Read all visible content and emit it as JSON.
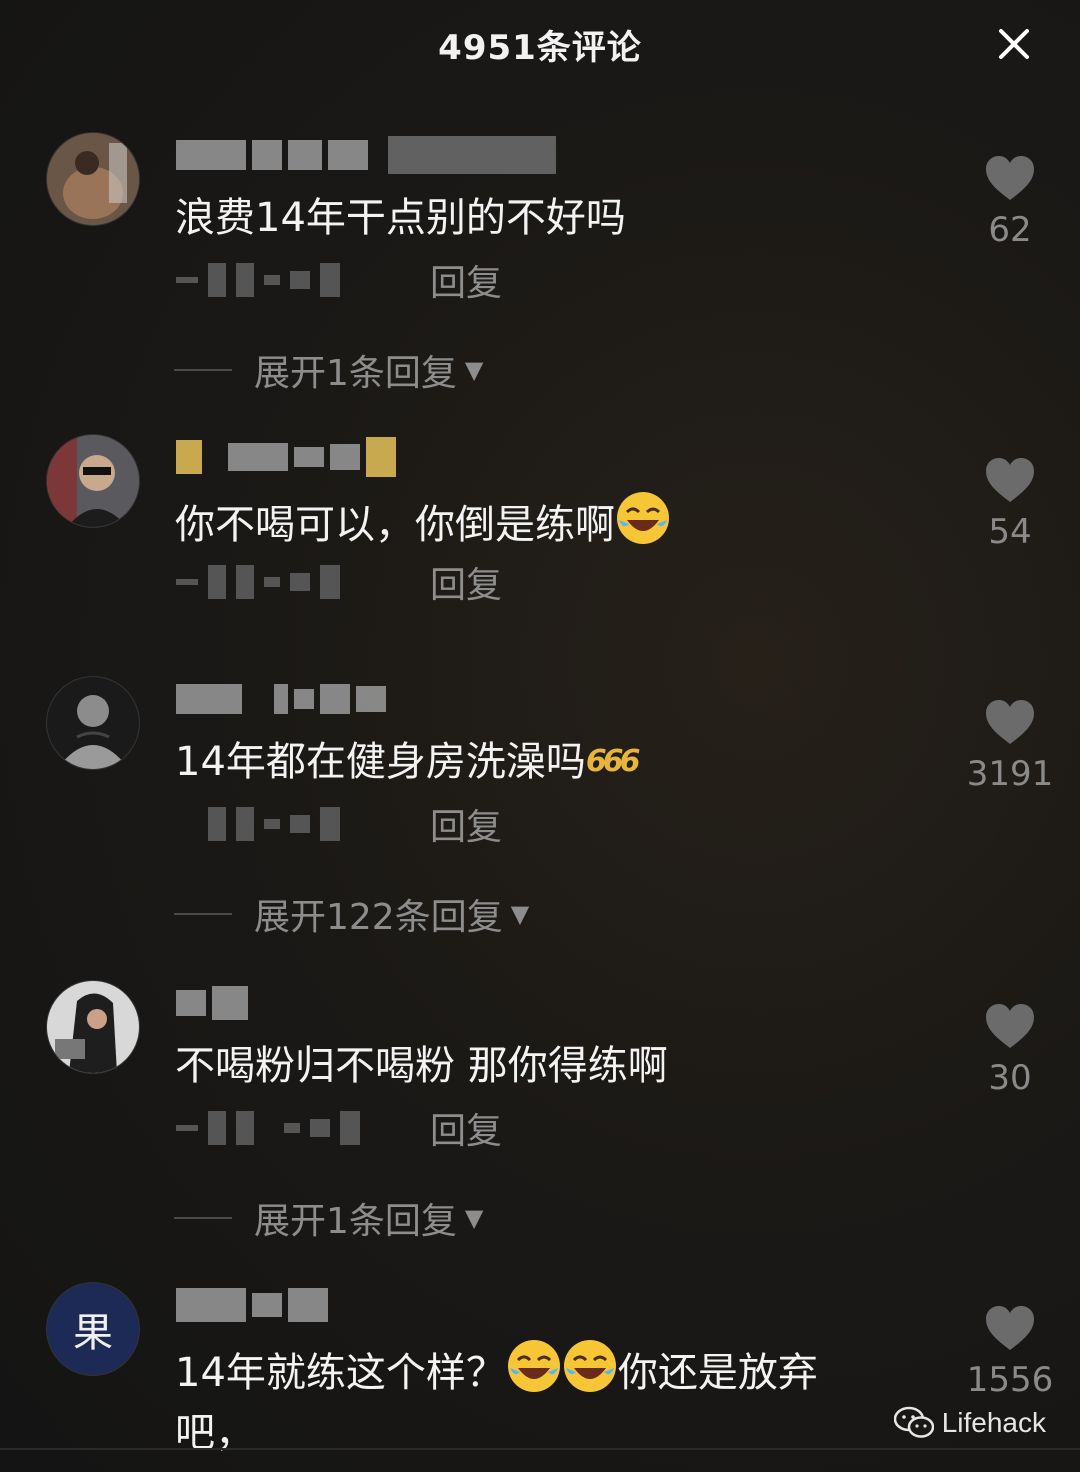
{
  "header": {
    "title": "4951条评论",
    "close_icon": "close-icon"
  },
  "comments": [
    {
      "text": "浪费14年干点别的不好吗",
      "reply_label": "回复",
      "likes": "62",
      "expand": "展开1条回复"
    },
    {
      "text": "你不喝可以，你倒是练啊",
      "reply_label": "回复",
      "likes": "54",
      "expand": ""
    },
    {
      "text": "14年都在健身房洗澡吗",
      "badge": "666",
      "reply_label": "回复",
      "likes": "3191",
      "expand": "展开122条回复"
    },
    {
      "text": "不喝粉归不喝粉 那你得练啊",
      "reply_label": "回复",
      "likes": "30",
      "expand": "展开1条回复"
    },
    {
      "text": "14年就练这个样？",
      "text_tail": "你还是放弃吧，",
      "avatar_char": "果",
      "likes": "1556"
    }
  ],
  "watermark": {
    "label": "Lifehack"
  },
  "colors": {
    "background": "#1b1916",
    "text": "#f3f3f3",
    "muted": "#8d8d8d",
    "heart": "#6b6b6b",
    "badge": "#e7b53b",
    "avatar5_bg": "#1d2a55"
  }
}
